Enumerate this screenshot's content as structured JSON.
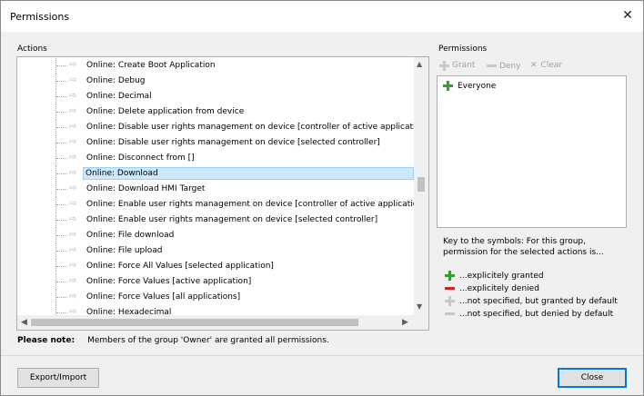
{
  "window": {
    "title": "Permissions"
  },
  "actions": {
    "label": "Actions",
    "items": [
      "Online: Create Boot Application",
      "Online: Debug",
      "Online: Decimal",
      "Online: Delete application from device",
      "Online: Disable user rights management on device [controller of active application]",
      "Online: Disable user rights management on device [selected controller]",
      "Online: Disconnect from []",
      "Online: Download",
      "Online: Download HMI Target",
      "Online: Enable user rights management on device [controller of active application]",
      "Online: Enable user rights management on device [selected controller]",
      "Online: File download",
      "Online: File upload",
      "Online: Force All Values [selected application]",
      "Online: Force Values [active application]",
      "Online: Force Values [all applications]",
      "Online: Hexadecimal"
    ],
    "selected_index": 7
  },
  "permissions": {
    "label": "Permissions",
    "toolbar": {
      "grant": "Grant",
      "deny": "Deny",
      "clear": "Clear"
    },
    "entries": [
      {
        "name": "Everyone",
        "state": "granted"
      }
    ]
  },
  "key": {
    "intro": "Key to the symbols: For this group, permission for the selected actions is...",
    "items": [
      {
        "text": "...explicitely granted",
        "color": "#2aa52a"
      },
      {
        "text": "...explicitely denied",
        "color": "#d42020"
      },
      {
        "text": "...not specified, but granted by default",
        "color": "#c8c8c8"
      },
      {
        "text": "...not specified, but denied by default",
        "color": "#c8c8c8"
      }
    ]
  },
  "note": {
    "label": "Please note:",
    "text": "Members of the group 'Owner' are granted all permissions."
  },
  "buttons": {
    "export_import": "Export/Import",
    "close": "Close"
  },
  "colors": {
    "selection": "#cce8ff",
    "accent": "#0078d7"
  }
}
